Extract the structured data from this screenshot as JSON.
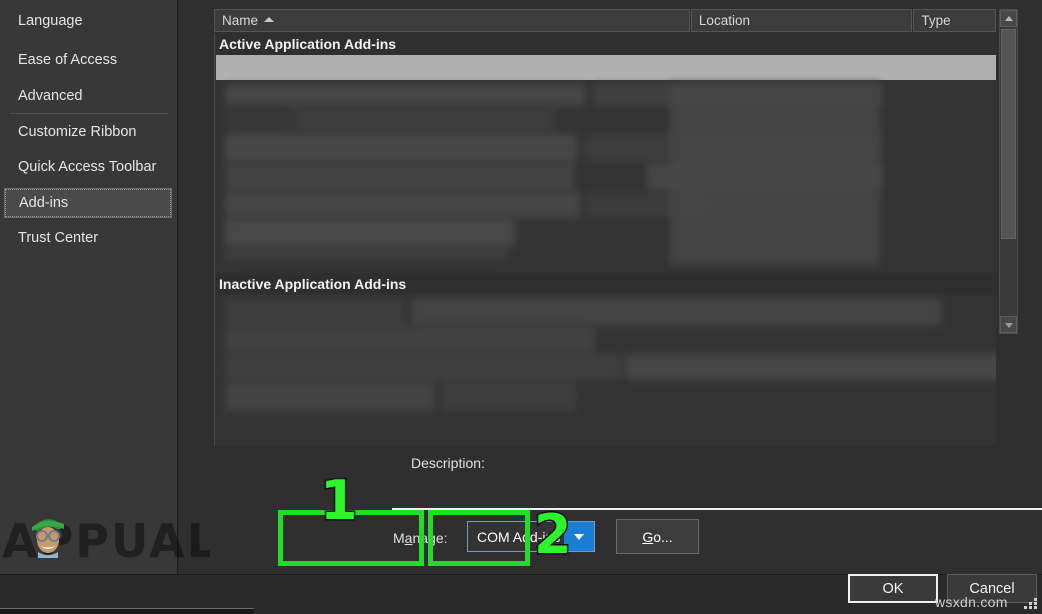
{
  "sidebar": {
    "items": [
      {
        "label": "Language",
        "selected": false
      },
      {
        "label": "Ease of Access",
        "selected": false
      },
      {
        "label": "Advanced",
        "selected": false
      },
      {
        "label": "Customize Ribbon",
        "selected": false
      },
      {
        "label": "Quick Access Toolbar",
        "selected": false
      },
      {
        "label": "Add-ins",
        "selected": true
      },
      {
        "label": "Trust Center",
        "selected": false
      }
    ]
  },
  "addins_list": {
    "columns": [
      {
        "label": "Name",
        "sorted": "ascending"
      },
      {
        "label": "Location",
        "sorted": "none"
      },
      {
        "label": "Type",
        "sorted": "none"
      }
    ],
    "groups": [
      {
        "label": "Active Application Add-ins"
      },
      {
        "label": "Inactive Application Add-ins"
      }
    ],
    "rows_redacted": true
  },
  "description": {
    "label": "Description:",
    "value": ""
  },
  "manage": {
    "label": "Manage:",
    "accel": "a",
    "selected_option": "COM Add-ins",
    "options": [
      "COM Add-ins"
    ],
    "go_label": "Go...",
    "go_accel": "G"
  },
  "dialog_buttons": {
    "ok": "OK",
    "cancel": "Cancel"
  },
  "annotations": [
    {
      "number": "1",
      "target": "manage-combobox"
    },
    {
      "number": "2",
      "target": "go-button"
    }
  ],
  "watermarks": {
    "brand": "APPUALS",
    "site": "wsxdn.com"
  },
  "colors": {
    "accent_green": "#22dd22",
    "number_green": "#2cf52c",
    "combo_blue": "#1a7fd4",
    "combo_border": "#6f9bd1",
    "window_bg": "#2b2b2b",
    "sidebar_bg": "#383838",
    "panel_bg": "#2f2f2f",
    "list_bg": "#333333",
    "selected_row": "#b0b0b0",
    "text": "#e6e6e6"
  }
}
